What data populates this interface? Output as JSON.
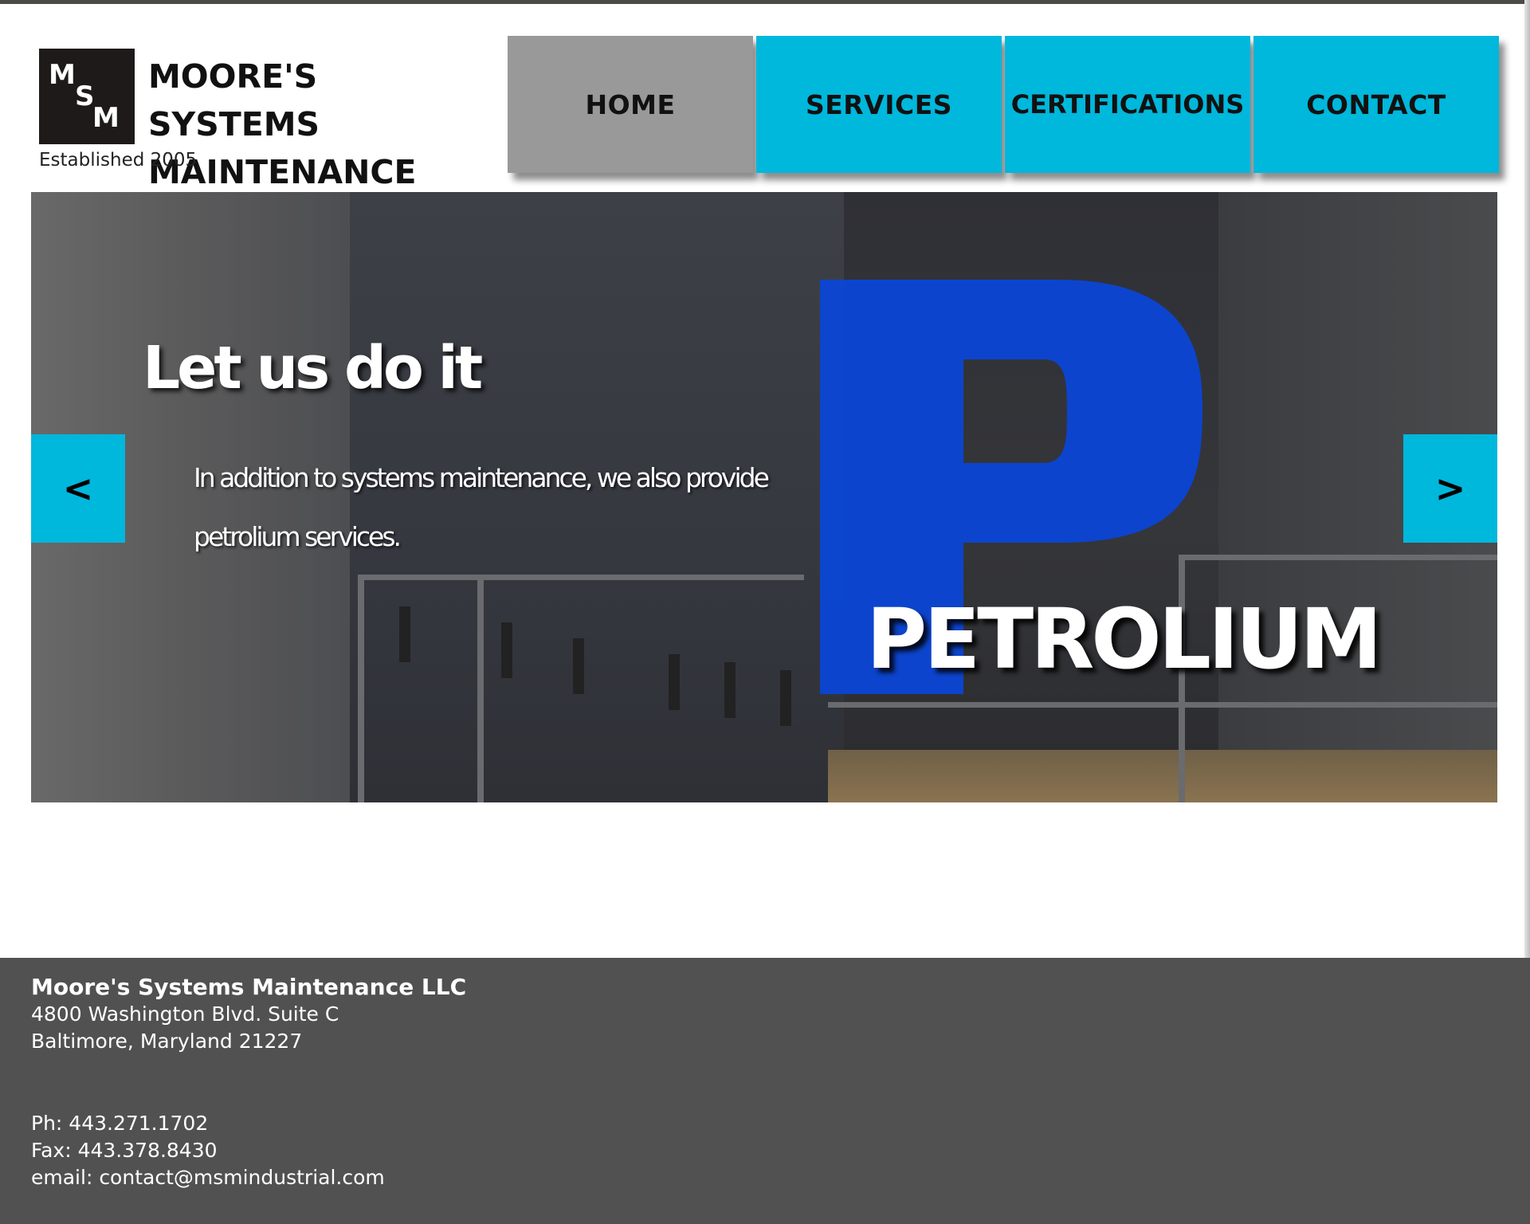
{
  "header": {
    "logo_letters": [
      "M",
      "S",
      "M"
    ],
    "brand_line1": "MOORE'S SYSTEMS",
    "brand_line2": "MAINTENANCE LLC",
    "established": "Established 2005"
  },
  "nav": {
    "items": [
      {
        "label": "HOME",
        "active": true
      },
      {
        "label": "SERVICES"
      },
      {
        "label": "CERTIFICATIONS"
      },
      {
        "label": "CONTACT"
      }
    ]
  },
  "hero": {
    "title": "Let us do it",
    "subtitle_line1": "In addition to systems maintenance, we also provide",
    "subtitle_line2": "petrolium services.",
    "big_letter": "P",
    "petrolium_label": "PETROLIUM",
    "prev_arrow": "<",
    "next_arrow": ">"
  },
  "footer": {
    "company": "Moore's Systems Maintenance LLC",
    "address_line1": "4800 Washington Blvd. Suite C",
    "address_line2": "Baltimore, Maryland 21227",
    "phone": "Ph: 443.271.1702",
    "fax": "Fax: 443.378.8430",
    "email": "email: contact@msmindustrial.com"
  },
  "colors": {
    "accent": "#00b7dc",
    "nav_active": "#999999",
    "footer_bg": "#525152",
    "petrolium_blue": "#0b46d6"
  }
}
